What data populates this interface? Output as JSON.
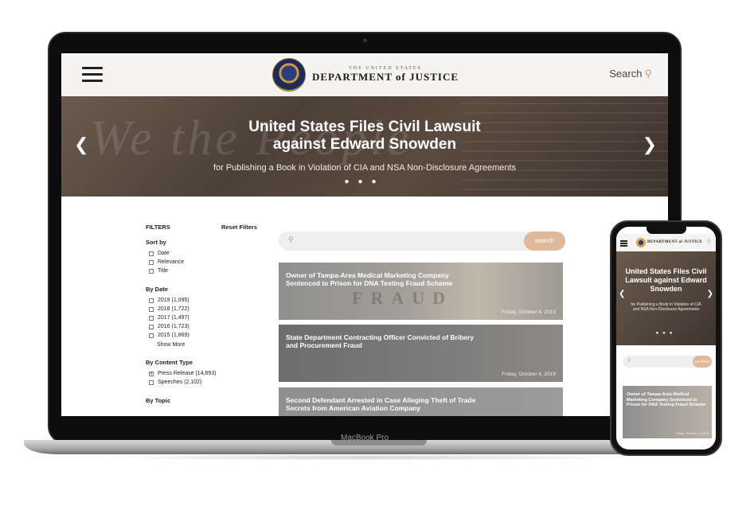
{
  "device": {
    "laptop_label": "MacBook Pro"
  },
  "site": {
    "logo_small": "THE UNITED STATES",
    "logo_big": "DEPARTMENT of JUSTICE",
    "search_label": "Search"
  },
  "hero": {
    "title": "United States Files Civil Lawsuit against Edward Snowden",
    "subtitle": "for Publishing a Book in Violation of CIA and NSA Non-Disclosure Agreements",
    "script_text": "We the People"
  },
  "filters": {
    "heading": "FILTERS",
    "reset": "Reset Filters",
    "sort_title": "Sort by",
    "sort": [
      "Date",
      "Relevance",
      "Title"
    ],
    "date_title": "By Date",
    "dates": [
      "2019 (1,095)",
      "2018 (1,722)",
      "2017 (1,497)",
      "2016 (1,723)",
      "2015 (1,869)"
    ],
    "show_more": "Show More",
    "content_title": "By Content Type",
    "content_types": [
      "Press Release (14,693)",
      "Speeches (2,102)"
    ],
    "topic_title": "By Topic"
  },
  "search": {
    "button": "search"
  },
  "results": [
    {
      "title": "Owner of Tampa-Area Medical Marketing Company Sentenced to Prison for DNA Testing Fraud Scheme",
      "date": "Friday, October 4, 2019",
      "image_text": "FRAUD"
    },
    {
      "title": "State Department Contracting Officer Convicted of Bribery and Procurement Fraud",
      "date": "Friday, October 4, 2019"
    },
    {
      "title": "Second Defendant Arrested in Case Alleging Theft of Trade Secrets from American Aviation Company",
      "date": ""
    }
  ],
  "phone": {
    "hero_title": "United States Files Civil Lawsuit against Edward Snowden",
    "hero_subtitle": "for Publishing a Book in Violation of CIA and NSA Non-Disclosure Agreements",
    "search_button": "Go Filters",
    "card_title": "Owner of Tampa-Area Medical Marketing Company Sentenced to Prison for DNA Testing Fraud Scheme",
    "card_date": "Friday, October 4, 2019"
  }
}
